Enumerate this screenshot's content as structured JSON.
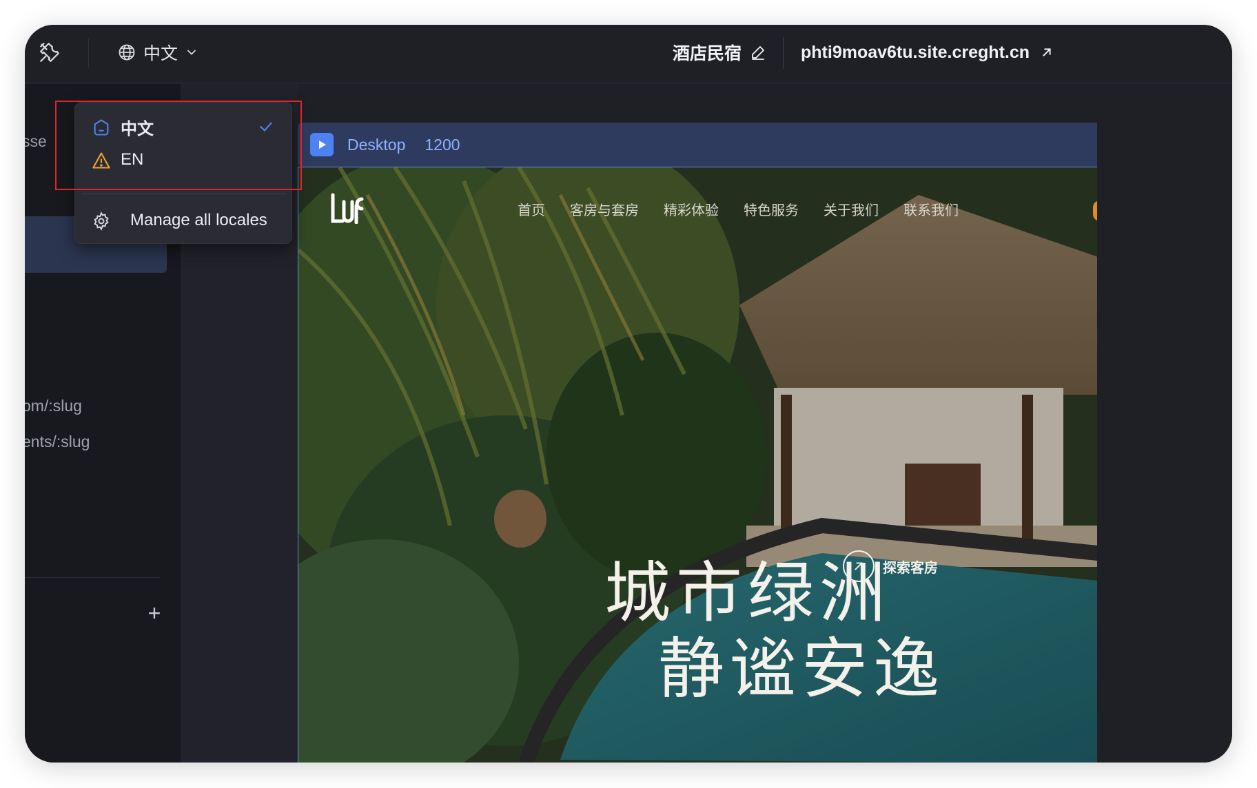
{
  "topbar": {
    "locale_label": "中文",
    "site_title": "酒店民宿",
    "site_url": "phti9moav6tu.site.creght.cn"
  },
  "locale_menu": {
    "items": [
      {
        "label": "中文",
        "status": "default",
        "selected": true
      },
      {
        "label": "EN",
        "status": "warning",
        "selected": false
      }
    ],
    "manage_label": "Manage all locales"
  },
  "sidebar": {
    "partial_text": "sse",
    "routes": [
      "om/:slug",
      "ents/:slug"
    ],
    "add_label": "+"
  },
  "canvas": {
    "device_name": "Desktop",
    "device_width": "1200"
  },
  "preview": {
    "nav": [
      "首页",
      "客房与套房",
      "精彩体验",
      "特色服务",
      "关于我们",
      "联系我们"
    ],
    "hero_line1": "城市绿洲",
    "hero_line2": "静谧安逸",
    "explore_label": "探索客房"
  },
  "colors": {
    "accent": "#4d82f3",
    "warning": "#f0a33a",
    "highlight": "#e0242b",
    "window_bg": "#1f2026"
  }
}
